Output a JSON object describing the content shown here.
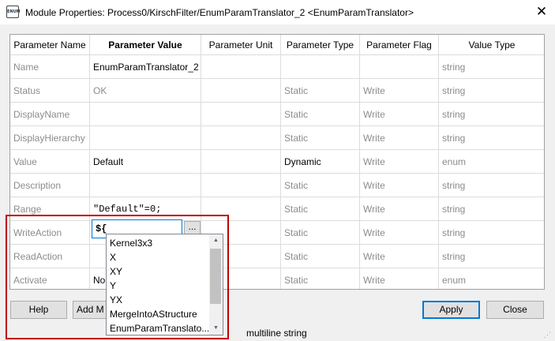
{
  "window": {
    "title": "Module Properties: Process0/KirschFilter/EnumParamTranslator_2 <EnumParamTranslator>",
    "icon_label": "ENUM",
    "close_glyph": "✕"
  },
  "grid": {
    "columns": [
      "Parameter Name",
      "Parameter Value",
      "Parameter Unit",
      "Parameter Type",
      "Parameter Flag",
      "Value Type"
    ],
    "rows": [
      {
        "name": "Name",
        "value": "EnumParamTranslator_2",
        "unit": "",
        "type": "",
        "flag": "",
        "vtype": "string"
      },
      {
        "name": "Status",
        "value": "OK",
        "unit": "",
        "type": "Static",
        "flag": "Write",
        "vtype": "string"
      },
      {
        "name": "DisplayName",
        "value": "",
        "unit": "",
        "type": "Static",
        "flag": "Write",
        "vtype": "string"
      },
      {
        "name": "DisplayHierarchy",
        "value": "",
        "unit": "",
        "type": "Static",
        "flag": "Write",
        "vtype": "string"
      },
      {
        "name": "Value",
        "value": "Default",
        "unit": "",
        "type": "Dynamic",
        "flag": "Write",
        "vtype": "enum"
      },
      {
        "name": "Description",
        "value": "",
        "unit": "",
        "type": "Static",
        "flag": "Write",
        "vtype": "string"
      },
      {
        "name": "Range",
        "value": "\"Default\"=0;",
        "unit": "",
        "type": "Static",
        "flag": "Write",
        "vtype": "string"
      },
      {
        "name": "WriteAction",
        "value": "",
        "unit": "",
        "type": "Static",
        "flag": "Write",
        "vtype": "string"
      },
      {
        "name": "ReadAction",
        "value": "",
        "unit": "",
        "type": "Static",
        "flag": "Write",
        "vtype": "string"
      },
      {
        "name": "Activate",
        "value": "No",
        "unit": "",
        "type": "Static",
        "flag": "Write",
        "vtype": "enum"
      }
    ]
  },
  "editor": {
    "value": "${",
    "ellipsis_label": "..."
  },
  "autocomplete": {
    "items": [
      "Kernel3x3",
      "X",
      "XY",
      "Y",
      "YX",
      "MergeIntoAStructure",
      "EnumParamTranslato..."
    ],
    "scroll_up": "▲",
    "scroll_down": "▼"
  },
  "buttons": {
    "help": "Help",
    "add_m": "Add M",
    "apply": "Apply",
    "close": "Close"
  },
  "status_text": "multiline string",
  "grip_glyph": "⋰"
}
